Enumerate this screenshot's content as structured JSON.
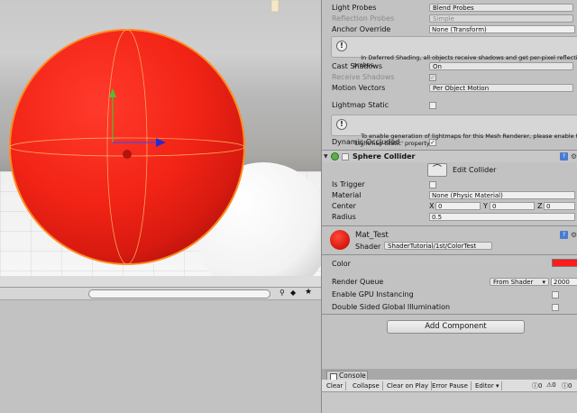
{
  "colors": {
    "sphere": "#ee2418",
    "selection_outline": "#ff8a1e",
    "material_color": "#ff1b1b"
  },
  "inspector": {
    "mesh_renderer": {
      "light_probes": {
        "label": "Light Probes",
        "value": "Blend Probes"
      },
      "reflection_probes": {
        "label": "Reflection Probes",
        "value": "Simple"
      },
      "anchor_override": {
        "label": "Anchor Override",
        "value": "None (Transform)"
      },
      "deferred_help": "In Deferred Shading, all objects receive shadows and get per-pixel reflectio\nprobes.",
      "cast_shadows": {
        "label": "Cast Shadows",
        "value": "On"
      },
      "receive_shadows": {
        "label": "Receive Shadows",
        "checked": true
      },
      "motion_vectors": {
        "label": "Motion Vectors",
        "value": "Per Object Motion"
      },
      "lightmap_static": {
        "label": "Lightmap Static",
        "checked": false
      },
      "lightmap_help": "To enable generation of lightmaps for this Mesh Renderer, please enable th\n'Lightmap Static' property.",
      "dynamic_occluded": {
        "label": "Dynamic Occluded",
        "checked": true
      }
    },
    "sphere_collider": {
      "title": "Sphere Collider",
      "edit_collider": "Edit Collider",
      "is_trigger": {
        "label": "Is Trigger",
        "checked": false
      },
      "material": {
        "label": "Material",
        "value": "None (Physic Material)"
      },
      "center": {
        "label": "Center",
        "x_label": "X",
        "x": "0",
        "y_label": "Y",
        "y": "0",
        "z_label": "Z",
        "z": "0"
      },
      "radius": {
        "label": "Radius",
        "value": "0.5"
      }
    },
    "material": {
      "name": "Mat_Test",
      "shader_label": "Shader",
      "shader_value": "ShaderTutorial/1st/ColorTest",
      "color_label": "Color",
      "render_queue_label": "Render Queue",
      "render_queue_mode": "From Shader",
      "render_queue_value": "2000",
      "gpu_instancing": {
        "label": "Enable GPU Instancing",
        "checked": false
      },
      "double_sided_gi": {
        "label": "Double Sided Global Illumination",
        "checked": false
      }
    },
    "add_component": "Add Component"
  },
  "console": {
    "tab": "Console",
    "buttons": [
      "Clear",
      "Collapse",
      "Clear on Play",
      "Error Pause",
      "Editor"
    ],
    "counts": [
      "0",
      "0",
      "0"
    ]
  }
}
